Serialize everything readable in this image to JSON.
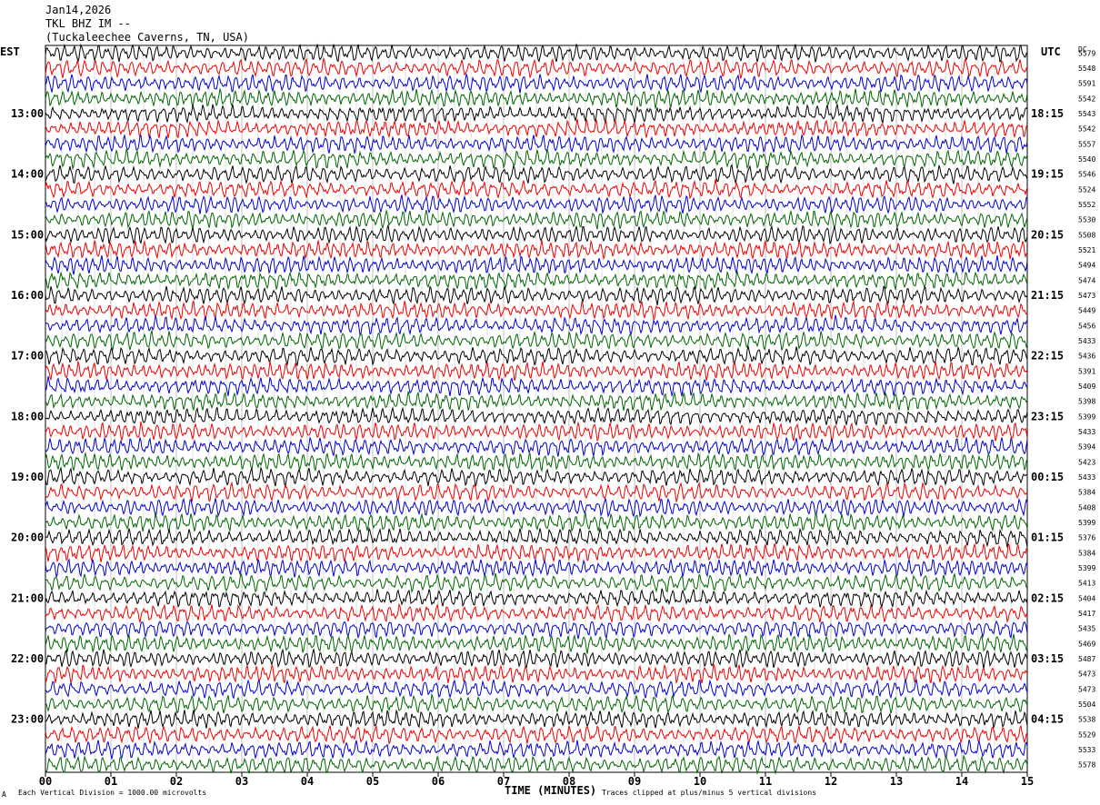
{
  "header": {
    "date": "Jan14,2026",
    "station": "TKL BHZ IM --",
    "location": "(Tuckaleechee Caverns, TN, USA)"
  },
  "left_axis_label": "EST",
  "right_axis_label": "UTC",
  "dc_label": "DC",
  "footer": {
    "scale_note": "Each Vertical Division = 1000.00 microvolts",
    "clip_note": "Traces clipped at plus/minus 5 vertical divisions",
    "corner_mark": "A"
  },
  "chart_data": {
    "type": "line",
    "title": "",
    "xlabel": "TIME (MINUTES)",
    "ylabel": "",
    "xlim": [
      0,
      15
    ],
    "x_ticks": [
      "00",
      "01",
      "02",
      "03",
      "04",
      "05",
      "06",
      "07",
      "08",
      "09",
      "10",
      "11",
      "12",
      "13",
      "14",
      "15"
    ],
    "row_count": 48,
    "left_time_labels": [
      "",
      "13:00",
      "14:00",
      "15:00",
      "16:00",
      "17:00",
      "18:00",
      "19:00",
      "20:00",
      "21:00",
      "22:00",
      "23:00"
    ],
    "right_time_labels": [
      "",
      "18:15",
      "19:15",
      "20:15",
      "21:15",
      "22:15",
      "23:15",
      "00:15",
      "01:15",
      "02:15",
      "03:15",
      "04:15"
    ],
    "dc_offsets": [
      5579,
      5548,
      5591,
      5542,
      5543,
      5542,
      5557,
      5540,
      5546,
      5524,
      5552,
      5530,
      5508,
      5521,
      5494,
      5474,
      5473,
      5449,
      5456,
      5433,
      5436,
      5391,
      5409,
      5398,
      5399,
      5433,
      5394,
      5423,
      5433,
      5384,
      5408,
      5399,
      5376,
      5384,
      5399,
      5413,
      5404,
      5417,
      5435,
      5469,
      5487,
      5473,
      5473,
      5504,
      5538,
      5529,
      5533,
      5578
    ],
    "trace_colors": [
      "#000000",
      "#ee0000",
      "#0000cc",
      "#006600"
    ],
    "grid": true
  }
}
